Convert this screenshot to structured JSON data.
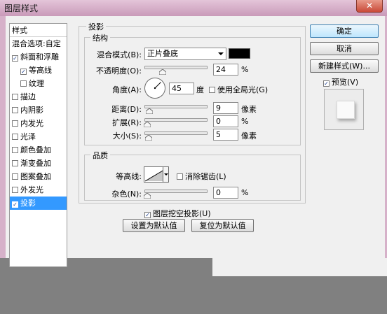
{
  "window": {
    "title": "图层样式",
    "close_glyph": "✕"
  },
  "styles_list": {
    "header": "样式",
    "items": [
      {
        "label": "混合选项:自定",
        "checkbox": false,
        "checked": false,
        "selected": false,
        "indent": 0
      },
      {
        "label": "斜面和浮雕",
        "checkbox": true,
        "checked": true,
        "selected": false,
        "indent": 0
      },
      {
        "label": "等高线",
        "checkbox": true,
        "checked": true,
        "selected": false,
        "indent": 1
      },
      {
        "label": "纹理",
        "checkbox": true,
        "checked": false,
        "selected": false,
        "indent": 1
      },
      {
        "label": "描边",
        "checkbox": true,
        "checked": false,
        "selected": false,
        "indent": 0
      },
      {
        "label": "内阴影",
        "checkbox": true,
        "checked": false,
        "selected": false,
        "indent": 0
      },
      {
        "label": "内发光",
        "checkbox": true,
        "checked": false,
        "selected": false,
        "indent": 0
      },
      {
        "label": "光泽",
        "checkbox": true,
        "checked": false,
        "selected": false,
        "indent": 0
      },
      {
        "label": "颜色叠加",
        "checkbox": true,
        "checked": false,
        "selected": false,
        "indent": 0
      },
      {
        "label": "渐变叠加",
        "checkbox": true,
        "checked": false,
        "selected": false,
        "indent": 0
      },
      {
        "label": "图案叠加",
        "checkbox": true,
        "checked": false,
        "selected": false,
        "indent": 0
      },
      {
        "label": "外发光",
        "checkbox": true,
        "checked": false,
        "selected": false,
        "indent": 0
      },
      {
        "label": "投影",
        "checkbox": true,
        "checked": true,
        "selected": true,
        "indent": 0
      }
    ]
  },
  "drop_shadow": {
    "title": "投影",
    "structure": {
      "title": "结构",
      "blend_mode_label": "混合模式(B):",
      "blend_mode_value": "正片叠底",
      "shadow_color": "#000000",
      "opacity_label": "不透明度(O):",
      "opacity_value": "24",
      "opacity_unit": "%",
      "opacity_level": 0.24,
      "angle_label": "角度(A):",
      "angle_value": "45",
      "angle_unit": "度",
      "global_light_label": "使用全局光(G)",
      "global_light_checked": false,
      "distance_label": "距离(D):",
      "distance_value": "9",
      "distance_unit": "像素",
      "distance_level": 0.03,
      "spread_label": "扩展(R):",
      "spread_value": "0",
      "spread_unit": "%",
      "spread_level": 0.0,
      "size_label": "大小(S):",
      "size_value": "5",
      "size_unit": "像素",
      "size_level": 0.02
    },
    "quality": {
      "title": "品质",
      "contour_label": "等高线:",
      "anti_alias_label": "消除锯齿(L)",
      "anti_alias_checked": false,
      "noise_label": "杂色(N):",
      "noise_value": "0",
      "noise_unit": "%",
      "noise_level": 0.0
    },
    "knockout_label": "图层挖空投影(U)",
    "knockout_checked": true,
    "make_default_label": "设置为默认值",
    "reset_default_label": "复位为默认值"
  },
  "buttons": {
    "ok": "确定",
    "cancel": "取消",
    "new_style": "新建样式(W)...",
    "preview_label": "预览(V)",
    "preview_checked": true
  },
  "colors": {
    "selection": "#3399ff",
    "title_bar": "#d6b1c9"
  }
}
